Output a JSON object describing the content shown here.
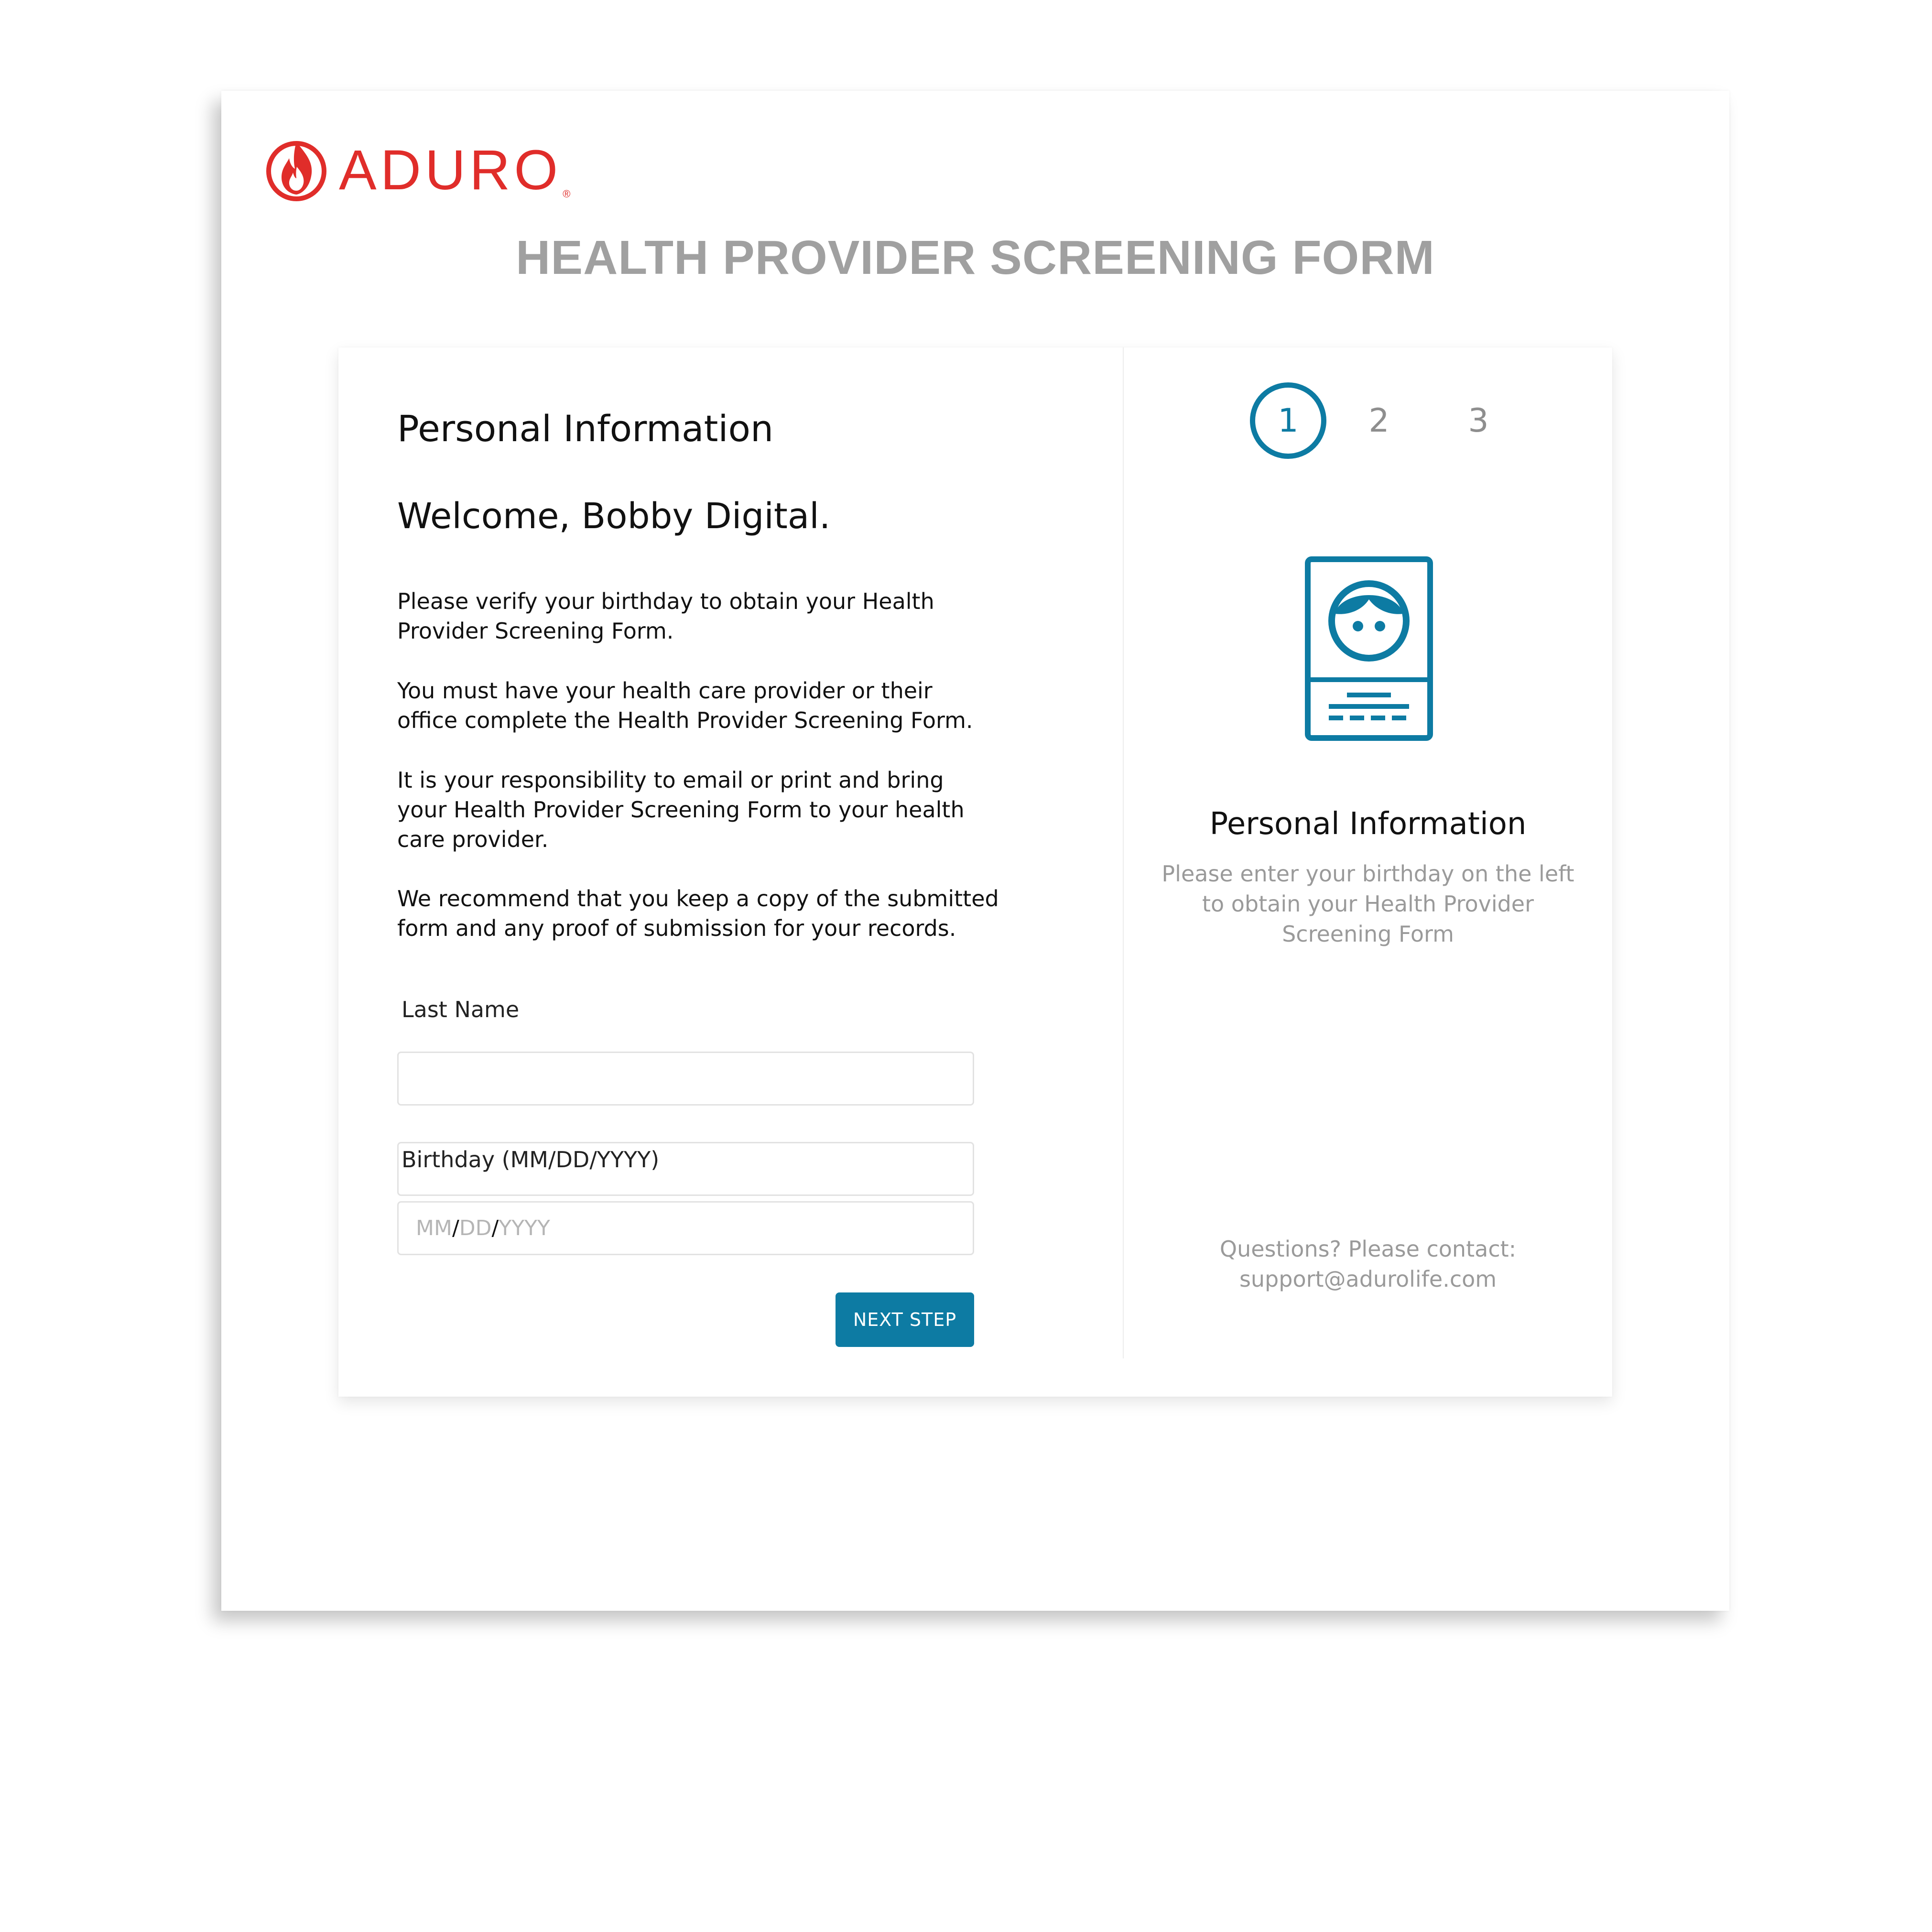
{
  "brand": {
    "name": "ADURO",
    "registered_mark": "®",
    "color": "#e02d2a"
  },
  "page": {
    "title": "HEALTH PROVIDER SCREENING FORM"
  },
  "form": {
    "section_heading": "Personal Information",
    "welcome": "Welcome, Bobby Digital.",
    "paragraphs": [
      "Please verify your birthday to obtain your Health Provider Screening Form.",
      "You must have your health care provider or their office complete the Health Provider Screening Form.",
      "It is your responsibility to email or print and bring your Health Provider Screening Form to your health care provider.",
      "We recommend that you keep a copy of the submitted form and any proof of submission for your records."
    ],
    "last_name": {
      "label": "Last Name",
      "value": ""
    },
    "birthday": {
      "label": "Birthday (MM/DD/YYYY)",
      "value": "",
      "mask": {
        "month": "MM",
        "day": "DD",
        "year": "YYYY",
        "separator": "/"
      }
    },
    "next_button_label": "NEXT STEP"
  },
  "steps": {
    "items": [
      "1",
      "2",
      "3"
    ],
    "active_index": 0,
    "accent_color": "#0d7ba3"
  },
  "sidebar": {
    "icon": "id-badge-icon",
    "heading": "Personal Information",
    "description": "Please enter your birthday on the left to obtain your Health Provider Screening Form",
    "contact_label": "Questions? Please contact:",
    "contact_email": "support@adurolife.com"
  }
}
